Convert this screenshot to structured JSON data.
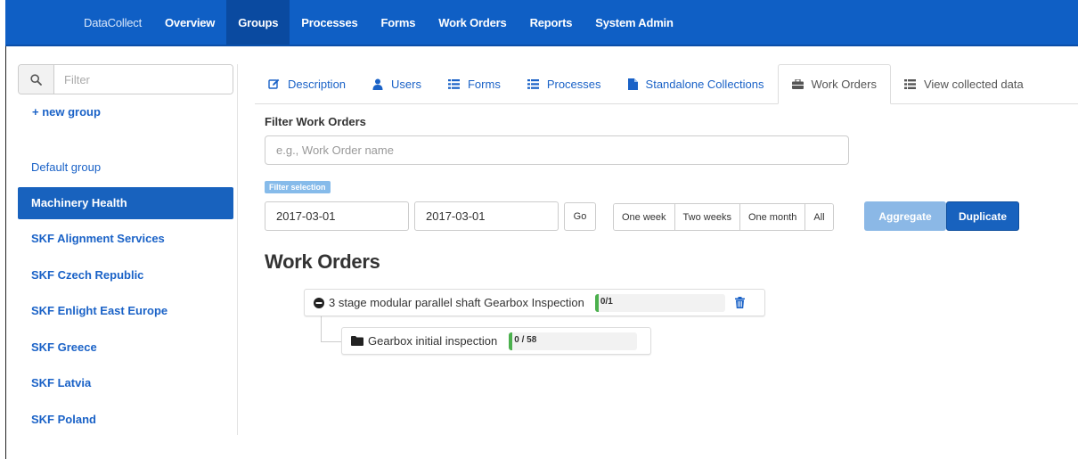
{
  "navbar": {
    "brand": "DataCollect",
    "items": [
      "Overview",
      "Groups",
      "Processes",
      "Forms",
      "Work Orders",
      "Reports",
      "System Admin"
    ],
    "active": "Groups"
  },
  "sidebar": {
    "search_placeholder": "Filter",
    "new_group": "+ new group",
    "groups": [
      "Default group",
      "Machinery Health",
      "SKF Alignment Services",
      "SKF Czech Republic",
      "SKF Enlight East Europe",
      "SKF Greece",
      "SKF Latvia",
      "SKF Poland"
    ],
    "active_group": "Machinery Health"
  },
  "tabs": [
    {
      "label": "Description",
      "icon": "edit-icon"
    },
    {
      "label": "Users",
      "icon": "user-icon"
    },
    {
      "label": "Forms",
      "icon": "list-icon"
    },
    {
      "label": "Processes",
      "icon": "list-icon"
    },
    {
      "label": "Standalone Collections",
      "icon": "file-icon"
    },
    {
      "label": "Work Orders",
      "icon": "briefcase-icon"
    },
    {
      "label": "View collected data",
      "icon": "list-view-icon"
    }
  ],
  "active_tab": "Work Orders",
  "filter": {
    "title": "Filter Work Orders",
    "placeholder": "e.g., Work Order name",
    "selection_badge": "Filter selection",
    "date_from": "2017-03-01",
    "date_to": "2017-03-01",
    "go_label": "Go",
    "ranges": [
      "One week",
      "Two weeks",
      "One month",
      "All"
    ],
    "aggregate_label": "Aggregate",
    "duplicate_label": "Duplicate"
  },
  "work_orders": {
    "heading": "Work Orders",
    "parent": {
      "name": "3 stage modular parallel shaft Gearbox Inspection",
      "progress_text": "0/1",
      "progress_fraction": 0
    },
    "child": {
      "name": "Gearbox initial inspection",
      "progress_text": "0 / 58",
      "progress_fraction": 0
    }
  },
  "colors": {
    "navbar": "#0f5fc5",
    "primary": "#1862be",
    "link": "#1a62c7",
    "progress_fill": "#4bb04d"
  }
}
